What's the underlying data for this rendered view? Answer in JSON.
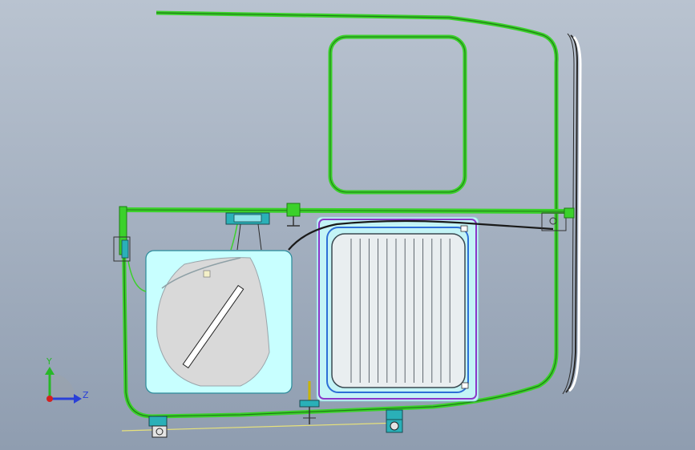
{
  "viewport": {
    "background_top": "#b9c3d0",
    "background_bottom": "#8f9db0"
  },
  "palette": {
    "wire_green": "#3bd12b",
    "wire_dark": "#1e7a14",
    "window_fill": "#c8ffff",
    "window_stroke": "#2a8a9a",
    "frame_purple": "#8a38c8",
    "frame_blue": "#2d6fd6",
    "glass_fill": "#e9eef0",
    "louver_stroke": "#505860",
    "grey_shape": "#d9d9d9",
    "cable_dark": "#1a1a1a",
    "guide_yellow": "#e8e27a",
    "connector_teal": "#2ab0b8"
  },
  "axes_triad": {
    "y_label": "Y",
    "z_label": "Z",
    "y_color": "#28b828",
    "z_color": "#2a40d8",
    "origin_color": "#d42020"
  }
}
